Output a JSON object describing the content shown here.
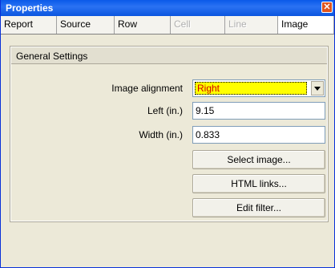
{
  "window": {
    "title": "Properties",
    "close_label": "✕"
  },
  "tabs": [
    {
      "label": "Report",
      "state": "normal"
    },
    {
      "label": "Source",
      "state": "normal"
    },
    {
      "label": "Row",
      "state": "normal"
    },
    {
      "label": "Cell",
      "state": "disabled"
    },
    {
      "label": "Line",
      "state": "disabled"
    },
    {
      "label": "Image",
      "state": "active"
    }
  ],
  "general": {
    "title": "General Settings",
    "image_alignment_label": "Image alignment",
    "image_alignment_value": "Right",
    "left_label": "Left (in.)",
    "left_value": "9.15",
    "width_label": "Width (in.)",
    "width_value": "0.833",
    "select_image_label": "Select image...",
    "html_links_label": "HTML links...",
    "edit_filter_label": "Edit filter..."
  },
  "colors": {
    "title_bar": "#0a5ae8",
    "highlight": "#ffff00",
    "highlight_text": "#d00000"
  }
}
